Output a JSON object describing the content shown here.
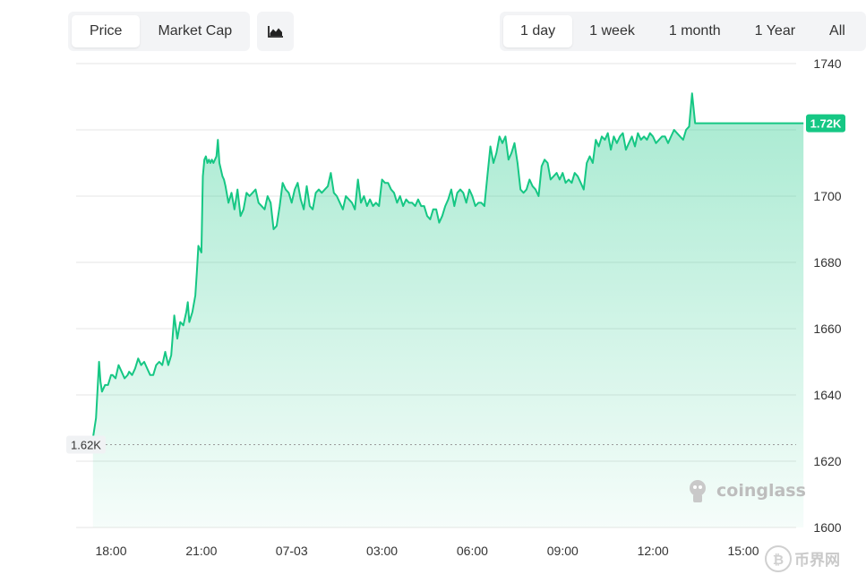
{
  "toolbar": {
    "metric_tabs": [
      {
        "label": "Price",
        "active": true
      },
      {
        "label": "Market Cap",
        "active": false
      }
    ],
    "chart_type_icon": "area-chart-icon",
    "range_tabs": [
      {
        "label": "1 day",
        "active": true
      },
      {
        "label": "1 week",
        "active": false
      },
      {
        "label": "1 month",
        "active": false
      },
      {
        "label": "1 Year",
        "active": false
      },
      {
        "label": "All",
        "active": false
      }
    ]
  },
  "watermark": "coinglass",
  "corner_watermark": "币界网",
  "colors": {
    "line": "#16c784",
    "badge": "#16c784",
    "grid": "#e6e6e6",
    "button_bg": "#f3f4f6"
  },
  "chart_data": {
    "type": "area",
    "title": "",
    "xlabel": "",
    "ylabel": "",
    "ylim": [
      1600,
      1740
    ],
    "y_ticks": [
      1600,
      1620,
      1640,
      1660,
      1680,
      1700,
      1720,
      1740
    ],
    "y_tick_labels": [
      "1600",
      "1620",
      "1640",
      "1660",
      "1680",
      "1700",
      "",
      "1740"
    ],
    "x_tick_labels": [
      "18:00",
      "21:00",
      "07-03",
      "03:00",
      "06:00",
      "09:00",
      "12:00",
      "15:00"
    ],
    "x_hours_range": [
      -0.6,
      23.1
    ],
    "current_price_label": "1.72K",
    "current_price": 1722,
    "start_price_label": "1.62K",
    "start_price": 1625,
    "grid": true,
    "series": [
      {
        "name": "",
        "x_hours": [
          -0.6,
          -0.5,
          -0.4,
          -0.35,
          -0.3,
          -0.25,
          -0.2,
          -0.1,
          0.0,
          0.05,
          0.15,
          0.25,
          0.35,
          0.45,
          0.55,
          0.6,
          0.7,
          0.8,
          0.9,
          1.0,
          1.1,
          1.2,
          1.3,
          1.4,
          1.5,
          1.6,
          1.7,
          1.8,
          1.9,
          2.0,
          2.1,
          2.2,
          2.3,
          2.4,
          2.5,
          2.55,
          2.6,
          2.7,
          2.8,
          2.85,
          2.9,
          3.0,
          3.05,
          3.1,
          3.15,
          3.2,
          3.25,
          3.3,
          3.35,
          3.4,
          3.5,
          3.55,
          3.6,
          3.7,
          3.75,
          3.8,
          3.9,
          4.0,
          4.1,
          4.2,
          4.3,
          4.4,
          4.5,
          4.6,
          4.7,
          4.8,
          4.9,
          5.0,
          5.1,
          5.2,
          5.3,
          5.4,
          5.5,
          5.6,
          5.7,
          5.8,
          5.9,
          6.0,
          6.1,
          6.2,
          6.3,
          6.4,
          6.5,
          6.6,
          6.7,
          6.8,
          6.9,
          7.0,
          7.1,
          7.2,
          7.3,
          7.4,
          7.5,
          7.6,
          7.7,
          7.8,
          7.9,
          8.0,
          8.1,
          8.2,
          8.3,
          8.4,
          8.5,
          8.6,
          8.7,
          8.8,
          8.9,
          9.0,
          9.1,
          9.2,
          9.3,
          9.4,
          9.5,
          9.6,
          9.7,
          9.8,
          9.9,
          10.0,
          10.1,
          10.2,
          10.3,
          10.4,
          10.5,
          10.6,
          10.7,
          10.8,
          10.9,
          11.0,
          11.1,
          11.2,
          11.3,
          11.4,
          11.5,
          11.6,
          11.7,
          11.8,
          11.9,
          12.0,
          12.1,
          12.2,
          12.3,
          12.4,
          12.5,
          12.6,
          12.7,
          12.8,
          12.9,
          13.0,
          13.1,
          13.2,
          13.3,
          13.4,
          13.5,
          13.6,
          13.7,
          13.8,
          13.9,
          14.0,
          14.1,
          14.2,
          14.3,
          14.4,
          14.5,
          14.6,
          14.7,
          14.8,
          14.9,
          15.0,
          15.1,
          15.2,
          15.3,
          15.4,
          15.5,
          15.6,
          15.7,
          15.8,
          15.9,
          16.0,
          16.1,
          16.2,
          16.3,
          16.4,
          16.5,
          16.6,
          16.7,
          16.8,
          16.9,
          17.0,
          17.1,
          17.2,
          17.3,
          17.4,
          17.5,
          17.6,
          17.7,
          17.8,
          17.9,
          18.0,
          18.1,
          18.2,
          18.3,
          18.4,
          18.5,
          18.6,
          18.7,
          18.8,
          18.9,
          19.0,
          19.1,
          19.2,
          19.3,
          19.4,
          19.5,
          19.6,
          19.7,
          19.8,
          19.9,
          20.0,
          20.1,
          20.2,
          20.3,
          20.4,
          20.5,
          20.6,
          20.7,
          20.8,
          20.9,
          21.0,
          21.1,
          21.2,
          21.3,
          21.4,
          21.5,
          21.6,
          21.7,
          21.8,
          21.9,
          22.0,
          22.1,
          22.2,
          22.3,
          22.4,
          22.5,
          22.6,
          22.7,
          22.8,
          22.9,
          22.95,
          23.0
        ],
        "values": [
          1627,
          1633,
          1650,
          1644,
          1641,
          1642,
          1643,
          1643,
          1646,
          1646,
          1645,
          1649,
          1647,
          1645,
          1646,
          1647,
          1646,
          1648,
          1651,
          1649,
          1650,
          1648,
          1646,
          1646,
          1649,
          1650,
          1649,
          1653,
          1649,
          1652,
          1664,
          1657,
          1662,
          1661,
          1665,
          1668,
          1662,
          1665,
          1670,
          1677,
          1685,
          1683,
          1706,
          1711,
          1712,
          1710,
          1711,
          1710,
          1711,
          1710,
          1712,
          1717,
          1710,
          1706,
          1705,
          1703,
          1698,
          1701,
          1696,
          1702,
          1694,
          1696,
          1701,
          1700,
          1701,
          1702,
          1698,
          1697,
          1696,
          1700,
          1698,
          1690,
          1691,
          1697,
          1704,
          1702,
          1701,
          1698,
          1702,
          1704,
          1699,
          1696,
          1703,
          1697,
          1696,
          1701,
          1702,
          1701,
          1702,
          1703,
          1707,
          1701,
          1700,
          1698,
          1696,
          1700,
          1699,
          1698,
          1696,
          1705,
          1698,
          1700,
          1697,
          1699,
          1697,
          1698,
          1697,
          1705,
          1704,
          1704,
          1702,
          1701,
          1698,
          1700,
          1697,
          1699,
          1698,
          1698,
          1697,
          1699,
          1697,
          1697,
          1694,
          1693,
          1696,
          1696,
          1692,
          1694,
          1697,
          1699,
          1702,
          1697,
          1701,
          1702,
          1701,
          1698,
          1702,
          1700,
          1697,
          1698,
          1698,
          1697,
          1706,
          1715,
          1710,
          1713,
          1718,
          1716,
          1718,
          1711,
          1713,
          1716,
          1710,
          1702,
          1701,
          1702,
          1705,
          1703,
          1702,
          1700,
          1709,
          1711,
          1710,
          1705,
          1706,
          1707,
          1705,
          1707,
          1704,
          1705,
          1704,
          1707,
          1706,
          1704,
          1702,
          1710,
          1712,
          1710,
          1717,
          1715,
          1718,
          1717,
          1719,
          1714,
          1718,
          1716,
          1718,
          1719,
          1714,
          1716,
          1718,
          1715,
          1719,
          1717,
          1718,
          1717,
          1719,
          1718,
          1716,
          1717,
          1718,
          1718,
          1716,
          1718,
          1720,
          1719,
          1718,
          1717,
          1720,
          1721,
          1731,
          1722,
          1722,
          1722,
          1722,
          1722,
          1722,
          1722,
          1722,
          1722,
          1722,
          1722,
          1722,
          1722,
          1722,
          1722,
          1722,
          1722,
          1722,
          1722,
          1722,
          1722,
          1722,
          1722,
          1722,
          1722,
          1722,
          1722,
          1722,
          1722,
          1722,
          1722,
          1722,
          1722,
          1722,
          1722,
          1722,
          1722,
          1722,
          1722,
          1722,
          1722,
          1722,
          1722
        ]
      }
    ]
  }
}
